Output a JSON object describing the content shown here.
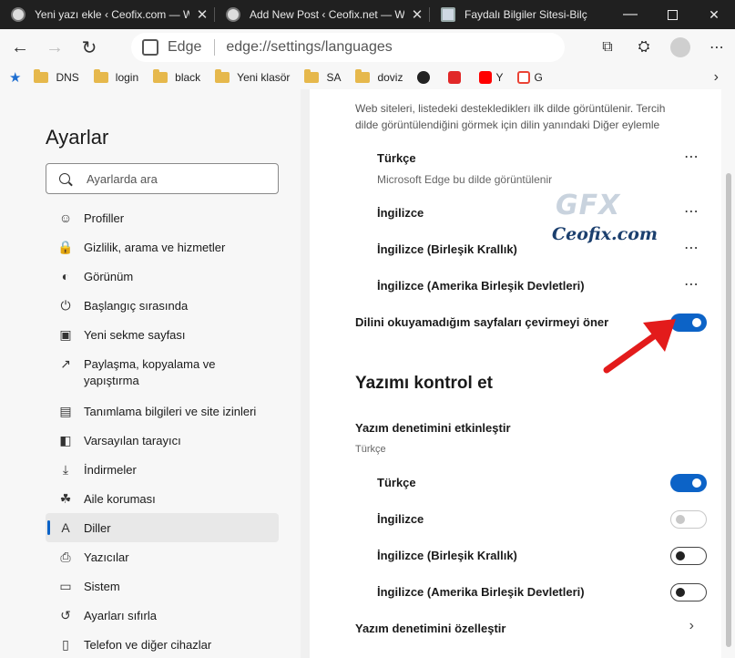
{
  "tabs": [
    {
      "title": "Yeni yazı ekle ‹ Ceofix.com — W",
      "icon": "wordpress-icon"
    },
    {
      "title": "Add New Post ‹ Ceofix.net — W",
      "icon": "wordpress-icon"
    },
    {
      "title": "Faydalı Bilgiler Sitesi-Bilç",
      "icon": "document-icon"
    }
  ],
  "address": {
    "brand": "Edge",
    "url": "edge://settings/languages"
  },
  "bookmarks": [
    {
      "label": "DNS",
      "type": "folder"
    },
    {
      "label": "login",
      "type": "folder"
    },
    {
      "label": "black",
      "type": "folder"
    },
    {
      "label": "Yeni klasör",
      "type": "folder"
    },
    {
      "label": "SA",
      "type": "folder"
    },
    {
      "label": "doviz",
      "type": "folder"
    }
  ],
  "bookmark_icons": [
    {
      "label": "",
      "icon": "tumblr-icon",
      "color": "#222222"
    },
    {
      "label": "",
      "icon": "flipboard-icon",
      "color": "#e12828"
    },
    {
      "label": "Y",
      "icon": "youtube-icon",
      "color": "#ff0000"
    },
    {
      "label": "G",
      "icon": "gmail-icon",
      "color": "#ea4335"
    }
  ],
  "sidebar": {
    "title": "Ayarlar",
    "search_placeholder": "Ayarlarda ara",
    "items": [
      {
        "label": "Profiller",
        "icon": "profile-icon"
      },
      {
        "label": "Gizlilik, arama ve hizmetler",
        "icon": "lock-icon"
      },
      {
        "label": "Görünüm",
        "icon": "palette-icon"
      },
      {
        "label": "Başlangıç sırasında",
        "icon": "power-icon"
      },
      {
        "label": "Yeni sekme sayfası",
        "icon": "new-tab-icon"
      },
      {
        "label": "Paylaşma, kopyalama ve yapıştırma",
        "icon": "share-icon"
      },
      {
        "label": "Tanımlama bilgileri ve site izinleri",
        "icon": "site-permissions-icon"
      },
      {
        "label": "Varsayılan tarayıcı",
        "icon": "browser-icon"
      },
      {
        "label": "İndirmeler",
        "icon": "download-icon"
      },
      {
        "label": "Aile koruması",
        "icon": "family-icon"
      },
      {
        "label": "Diller",
        "icon": "language-icon"
      },
      {
        "label": "Yazıcılar",
        "icon": "printer-icon"
      },
      {
        "label": "Sistem",
        "icon": "laptop-icon"
      },
      {
        "label": "Ayarları sıfırla",
        "icon": "reset-icon"
      },
      {
        "label": "Telefon ve diğer cihazlar",
        "icon": "phone-icon"
      }
    ],
    "active_index": 10
  },
  "main": {
    "desc_line1": "Web siteleri, listedeki desteklediklerı ilk dilde görüntülenir. Tercih",
    "desc_line2": "dilde görüntülendiğini görmek için dilin yanındaki Diğer eylemle",
    "languages": [
      {
        "name": "Türkçe",
        "sub": "Microsoft Edge bu dilde görüntülenir"
      },
      {
        "name": "İngilizce",
        "sub": ""
      },
      {
        "name": "İngilizce (Birleşik Krallık)",
        "sub": ""
      },
      {
        "name": "İngilizce (Amerika Birleşik Devletleri)",
        "sub": ""
      }
    ],
    "translate_label": "Dilini okuyamadığım sayfaları çevirmeyi öner",
    "translate_on": true,
    "spell_section_title": "Yazımı kontrol et",
    "spell_enable_label": "Yazım denetimini etkinleştir",
    "spell_enable_sub": "Türkçe",
    "spell_langs": [
      {
        "name": "Türkçe",
        "state": "on"
      },
      {
        "name": "İngilizce",
        "state": "disabled"
      },
      {
        "name": "İngilizce (Birleşik Krallık)",
        "state": "off"
      },
      {
        "name": "İngilizce (Amerika Birleşik Devletleri)",
        "state": "off"
      }
    ],
    "customize_label": "Yazım denetimini özelleştir"
  },
  "watermark": {
    "logo": "GFX",
    "site": "Ceofix.com"
  },
  "colors": {
    "accent": "#0c63c7",
    "arrow": "#e31b1b"
  }
}
